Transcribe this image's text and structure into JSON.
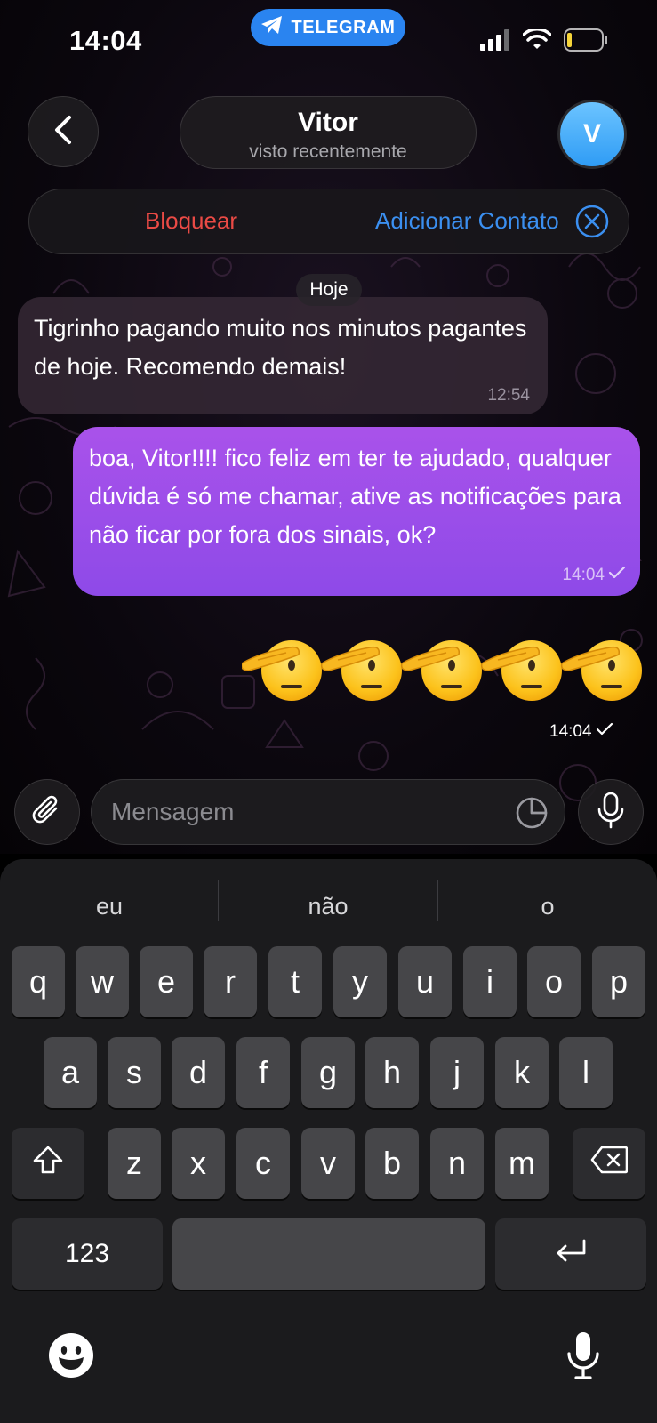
{
  "status_bar": {
    "time": "14:04",
    "app_pill": "TELEGRAM"
  },
  "header": {
    "contact_name": "Vitor",
    "contact_status": "visto recentemente",
    "avatar_initial": "V",
    "block_label": "Bloquear",
    "add_contact_label": "Adicionar Contato"
  },
  "chat": {
    "date_label": "Hoje",
    "messages": [
      {
        "direction": "incoming",
        "text": "Tigrinho pagando muito nos minutos pagantes de hoje. Recomendo demais!",
        "time": "12:54"
      },
      {
        "direction": "outgoing",
        "text": "boa, Vitor!!!! fico feliz em ter te ajudado, qualquer dúvida é só me chamar, ative as notificações para não ficar por fora dos sinais, ok?",
        "time": "14:04"
      },
      {
        "direction": "outgoing",
        "text": "🫡🫡🫡🫡🫡",
        "time": "14:04"
      }
    ]
  },
  "composer": {
    "placeholder": "Mensagem"
  },
  "keyboard": {
    "suggestions": [
      "eu",
      "não",
      "o"
    ],
    "row1": [
      "q",
      "w",
      "e",
      "r",
      "t",
      "y",
      "u",
      "i",
      "o",
      "p"
    ],
    "row2": [
      "a",
      "s",
      "d",
      "f",
      "g",
      "h",
      "j",
      "k",
      "l"
    ],
    "row3": [
      "z",
      "x",
      "c",
      "v",
      "b",
      "n",
      "m"
    ],
    "numbers_key": "123"
  },
  "colors": {
    "outgoing_bubble": "#9a4eea",
    "incoming_bubble": "#342834",
    "accent_blue": "#3b8ff0",
    "danger_red": "#ea4a45",
    "telegram_blue": "#2a84f0"
  },
  "icons": [
    "telegram-icon",
    "signal-icon",
    "wifi-icon",
    "battery-icon",
    "back-chevron-icon",
    "close-circle-icon",
    "read-check-icon",
    "attach-icon",
    "sticker-icon",
    "microphone-icon",
    "shift-icon",
    "backspace-icon",
    "return-icon",
    "emoji-icon",
    "dictation-icon"
  ]
}
